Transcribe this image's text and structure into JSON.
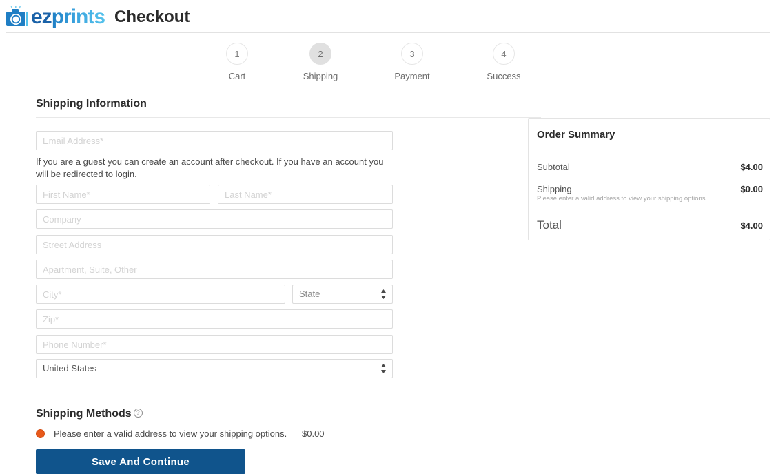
{
  "header": {
    "logo_ez": "ez",
    "logo_prints": "prints",
    "logo_icon": "camera-icon",
    "title": "Checkout"
  },
  "stepper": {
    "steps": [
      {
        "number": "1",
        "label": "Cart",
        "active": false
      },
      {
        "number": "2",
        "label": "Shipping",
        "active": true
      },
      {
        "number": "3",
        "label": "Payment",
        "active": false
      },
      {
        "number": "4",
        "label": "Success",
        "active": false
      }
    ]
  },
  "shipping_information": {
    "heading": "Shipping Information",
    "email_placeholder": "Email Address*",
    "guest_note": "If you are a guest you can create an account after checkout. If you have an account you will be redirected to login.",
    "first_name_placeholder": "First Name*",
    "last_name_placeholder": "Last Name*",
    "company_placeholder": "Company",
    "street_placeholder": "Street Address",
    "apartment_placeholder": "Apartment, Suite, Other",
    "city_placeholder": "City*",
    "state_value": "State",
    "zip_placeholder": "Zip*",
    "phone_placeholder": "Phone Number*",
    "country_value": "United States"
  },
  "shipping_methods": {
    "heading": "Shipping Methods",
    "help_icon": "question-mark-icon",
    "option_label": "Please enter a valid address to view your shipping options.",
    "option_price": "$0.00",
    "option_selected": true
  },
  "actions": {
    "save_label": "Save And Continue"
  },
  "order_summary": {
    "title": "Order Summary",
    "subtotal_label": "Subtotal",
    "subtotal_value": "$4.00",
    "shipping_label": "Shipping",
    "shipping_value": "$0.00",
    "shipping_note": "Please enter a valid address to view your shipping options.",
    "total_label": "Total",
    "total_value": "$4.00"
  },
  "colors": {
    "brand_dark_blue": "#1a62a8",
    "brand_light_blue": "#3aa3de",
    "button_blue": "#10548c",
    "radio_orange": "#e8591a",
    "border_gray": "#dcdcdc"
  }
}
